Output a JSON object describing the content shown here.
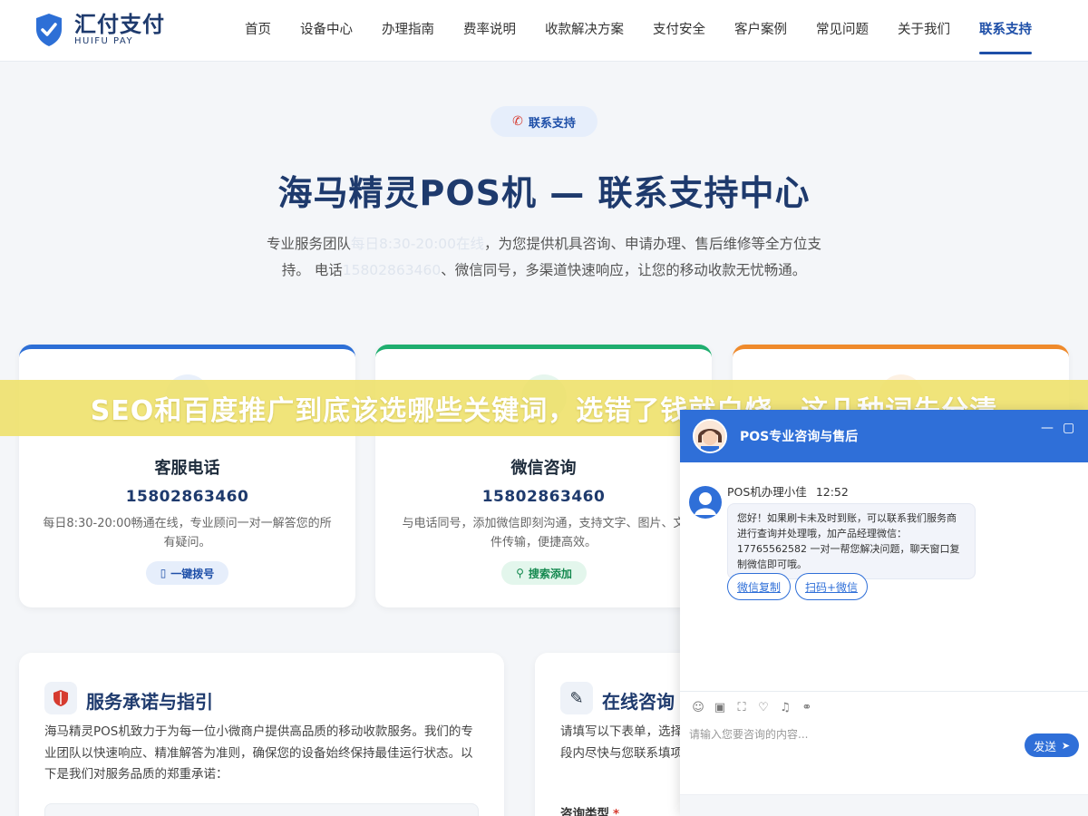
{
  "header": {
    "logo_cn": "汇付支付",
    "logo_en": "HUIFU PAY",
    "nav": [
      "首页",
      "设备中心",
      "办理指南",
      "费率说明",
      "收款解决方案",
      "支付安全",
      "客户案例",
      "常见问题",
      "关于我们",
      "联系支持"
    ],
    "active_nav": "联系支持"
  },
  "hero": {
    "pill": "联系支持",
    "title": "海马精灵POS机 — 联系支持中心",
    "desc_1": "专业服务团队",
    "desc_hl1": "每日8:30-20:00在线",
    "desc_2": "，为您提供机具咨询、申请办理、售后维修等全方位支持。 电话",
    "desc_hl2": "15802863460",
    "desc_3": "、微信同号，多渠道快速响应，让您的移动收款无忧畅通。"
  },
  "cards": [
    {
      "title": "客服电话",
      "number": "15802863460",
      "desc": "每日8:30-20:00畅通在线，专业顾问一对一解答您的所有疑问。",
      "button": "一键拨号"
    },
    {
      "title": "微信咨询",
      "number": "15802863460",
      "desc": "与电话同号，添加微信即刻沟通，支持文字、图片、文件传输，便捷高效。",
      "button": "搜索添加"
    }
  ],
  "panels": {
    "promise": {
      "title": "服务承诺与指引",
      "desc": "海马精灵POS机致力于为每一位小微商户提供高品质的移动收款服务。我们的专业团队以快速响应、精准解答为准则，确保您的设备始终保持最佳运行状态。以下是我们对服务品质的郑重承诺："
    },
    "online": {
      "title": "在线咨询",
      "desc": "请填写以下表单，选择时段内尽快与您联系填项。",
      "field_label": "咨询类型",
      "required_mark": "*"
    }
  },
  "banner": {
    "text": "SEO和百度推广到底该选哪些关键词，选错了钱就白烧，这几种词先分清"
  },
  "chat": {
    "title": "POS专业咨询与售后",
    "agent_name": "POS机办理小佳",
    "time": "12:52",
    "message": "您好！如果刷卡未及时到账，可以联系我们服务商进行查询并处理哦，加产品经理微信：17765562582 一对一帮您解决问题，聊天窗口复制微信即可哦。",
    "quick_1": "微信复制",
    "quick_2": "扫码+微信",
    "input_placeholder": "请输入您要咨询的内容...",
    "send_label": "发送"
  },
  "colors": {
    "brand": "#1e4fa8",
    "card_blue": "#2d6fd6",
    "card_green": "#1fae6f",
    "card_orange": "#ef8a2b",
    "chat_blue": "#2f6fd8",
    "banner": "#eee068"
  }
}
